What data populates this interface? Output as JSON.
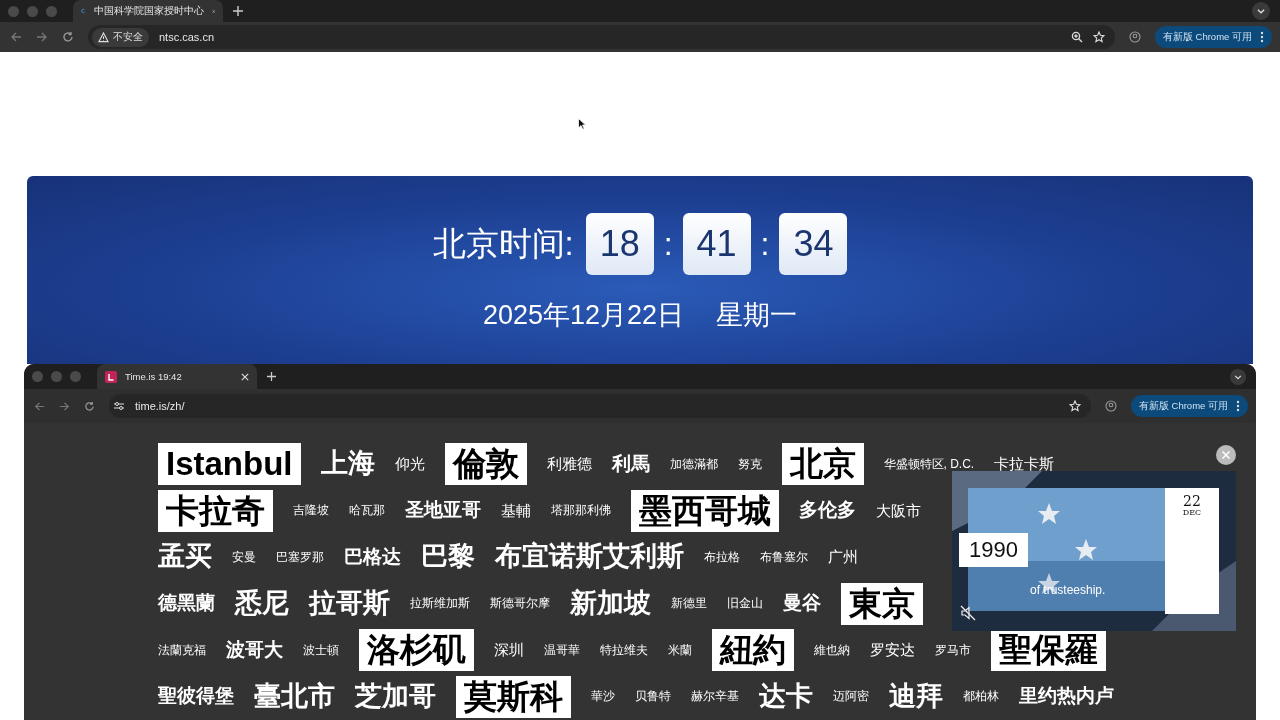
{
  "browser": {
    "tab_title": "中国科学院国家授时中心",
    "security_label": "不安全",
    "url": "ntsc.cas.cn",
    "update_button": "有新版 Chrome 可用"
  },
  "banner": {
    "clock_label": "北京时间:",
    "digits": [
      "18",
      "41",
      "34"
    ],
    "separators": [
      ":",
      ":"
    ],
    "date": "2025年12月22日",
    "weekday": "星期一"
  },
  "popup_browser": {
    "tab_title": "Time.is 19:42",
    "url": "time.is/zh/",
    "update_button": "有新版 Chrome 可用"
  },
  "city_rows": [
    {
      "cities": [
        {
          "name": "Istanbul",
          "kind": "boxed"
        },
        {
          "name": "上海",
          "kind": "large"
        },
        {
          "name": "仰光",
          "kind": "small"
        },
        {
          "name": "倫敦",
          "kind": "boxed"
        },
        {
          "name": "利雅德",
          "kind": "small"
        },
        {
          "name": "利馬",
          "kind": "medium"
        },
        {
          "name": "加德滿都",
          "kind": "tiny"
        },
        {
          "name": "努克",
          "kind": "tiny"
        },
        {
          "name": "北京",
          "kind": "boxed"
        },
        {
          "name": "华盛顿特区, D.C.",
          "kind": "tiny"
        },
        {
          "name": "卡拉卡斯",
          "kind": "small"
        }
      ]
    },
    {
      "cities": [
        {
          "name": "卡拉奇",
          "kind": "boxed"
        },
        {
          "name": "吉隆坡",
          "kind": "tiny"
        },
        {
          "name": "哈瓦那",
          "kind": "tiny"
        },
        {
          "name": "圣地亚哥",
          "kind": "medium"
        },
        {
          "name": "基輔",
          "kind": "small"
        },
        {
          "name": "塔那那利佛",
          "kind": "tiny"
        },
        {
          "name": "墨西哥城",
          "kind": "boxed"
        },
        {
          "name": "多伦多",
          "kind": "medium"
        },
        {
          "name": "大阪市",
          "kind": "small"
        }
      ]
    },
    {
      "cities": [
        {
          "name": "孟买",
          "kind": "large"
        },
        {
          "name": "安曼",
          "kind": "tiny"
        },
        {
          "name": "巴塞罗那",
          "kind": "tiny"
        },
        {
          "name": "巴格达",
          "kind": "medium"
        },
        {
          "name": "巴黎",
          "kind": "large"
        },
        {
          "name": "布宜诺斯艾利斯",
          "kind": "large"
        },
        {
          "name": "布拉格",
          "kind": "tiny"
        },
        {
          "name": "布鲁塞尔",
          "kind": "tiny"
        },
        {
          "name": "广州",
          "kind": "small"
        }
      ]
    },
    {
      "cities": [
        {
          "name": "德黑蘭",
          "kind": "medium"
        },
        {
          "name": "悉尼",
          "kind": "large"
        },
        {
          "name": "拉哥斯",
          "kind": "large"
        },
        {
          "name": "拉斯维加斯",
          "kind": "tiny"
        },
        {
          "name": "斯德哥尔摩",
          "kind": "tiny"
        },
        {
          "name": "新加坡",
          "kind": "large"
        },
        {
          "name": "新德里",
          "kind": "tiny"
        },
        {
          "name": "旧金山",
          "kind": "tiny"
        },
        {
          "name": "曼谷",
          "kind": "medium"
        },
        {
          "name": "東京",
          "kind": "boxed"
        }
      ]
    },
    {
      "cities": [
        {
          "name": "法蘭克福",
          "kind": "tiny"
        },
        {
          "name": "波哥大",
          "kind": "medium"
        },
        {
          "name": "波士頓",
          "kind": "tiny"
        },
        {
          "name": "洛杉矶",
          "kind": "boxed"
        },
        {
          "name": "深圳",
          "kind": "small"
        },
        {
          "name": "温哥華",
          "kind": "tiny"
        },
        {
          "name": "特拉维夫",
          "kind": "tiny"
        },
        {
          "name": "米蘭",
          "kind": "tiny"
        },
        {
          "name": "紐約",
          "kind": "boxed"
        },
        {
          "name": "維也納",
          "kind": "tiny"
        },
        {
          "name": "罗安达",
          "kind": "small"
        },
        {
          "name": "罗马市",
          "kind": "tiny"
        },
        {
          "name": "聖保羅",
          "kind": "boxed"
        }
      ]
    },
    {
      "cities": [
        {
          "name": "聖彼得堡",
          "kind": "medium"
        },
        {
          "name": "臺北市",
          "kind": "large"
        },
        {
          "name": "芝加哥",
          "kind": "large"
        },
        {
          "name": "莫斯科",
          "kind": "boxed"
        },
        {
          "name": "華沙",
          "kind": "tiny"
        },
        {
          "name": "贝鲁特",
          "kind": "tiny"
        },
        {
          "name": "赫尔辛基",
          "kind": "tiny"
        },
        {
          "name": "达卡",
          "kind": "large"
        },
        {
          "name": "迈阿密",
          "kind": "tiny"
        },
        {
          "name": "迪拜",
          "kind": "large"
        },
        {
          "name": "都柏林",
          "kind": "tiny"
        },
        {
          "name": "里约热内卢",
          "kind": "medium"
        }
      ]
    }
  ],
  "video": {
    "kind": "picture",
    "year": "1990",
    "day": "22",
    "month": "DEC",
    "caption": "of trusteeship."
  }
}
